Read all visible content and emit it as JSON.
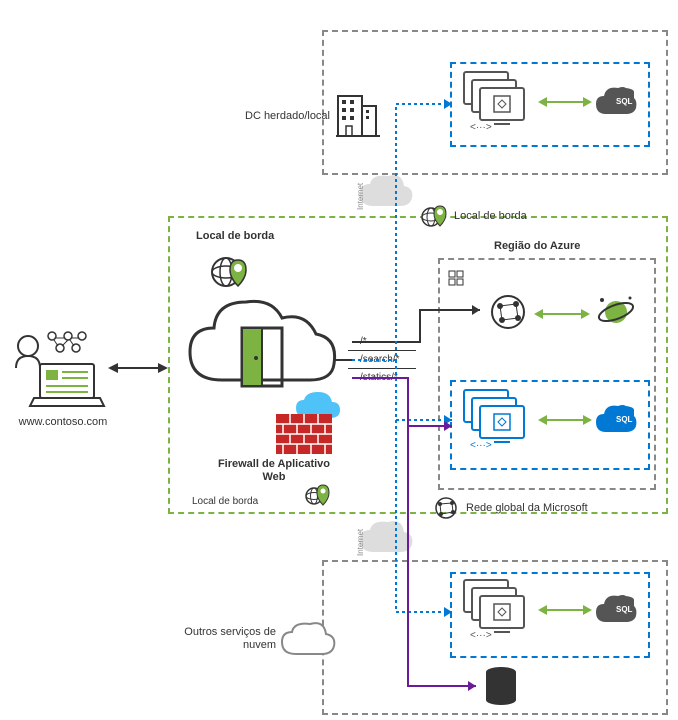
{
  "labels": {
    "dc_legacy": "DC herdado/local",
    "edge_location_top": "Local de borda",
    "edge_location_left": "Local de borda",
    "edge_location_bottom": "Local de borda",
    "azure_region": "Região do Azure",
    "waf": "Firewall de Aplicativo Web",
    "ms_global_network": "Rede global da Microsoft",
    "other_cloud": "Outros serviços de nuvem",
    "url": "www.contoso.com",
    "internet1": "Internet",
    "internet2": "Internet",
    "route_all": "/*",
    "route_search": "/search/*",
    "route_statics": "/statics/*"
  }
}
